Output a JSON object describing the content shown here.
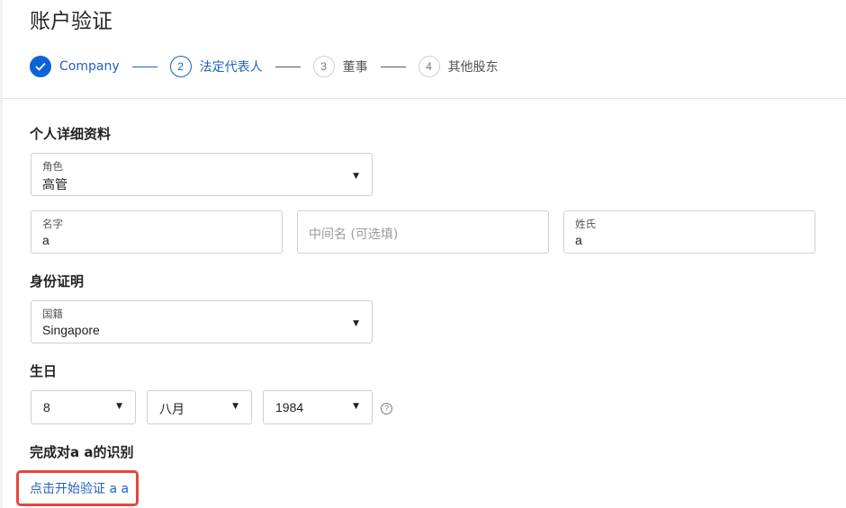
{
  "header": {
    "title": "账户验证"
  },
  "stepper": {
    "steps": [
      {
        "number": "",
        "label": "Company",
        "state": "done"
      },
      {
        "number": "2",
        "label": "法定代表人",
        "state": "active"
      },
      {
        "number": "3",
        "label": "董事",
        "state": "todo"
      },
      {
        "number": "4",
        "label": "其他股东",
        "state": "todo"
      }
    ]
  },
  "personal": {
    "title": "个人详细资料",
    "role": {
      "label": "角色",
      "value": "高管"
    },
    "first_name": {
      "label": "名字",
      "value": "a"
    },
    "middle_name": {
      "placeholder": "中间名 (可选填)"
    },
    "last_name": {
      "label": "姓氏",
      "value": "a"
    }
  },
  "identity": {
    "title": "身份证明",
    "nationality": {
      "label": "国籍",
      "value": "Singapore"
    }
  },
  "birthday": {
    "title": "生日",
    "day": "8",
    "month": "八月",
    "year": "1984",
    "help_glyph": "?"
  },
  "verification": {
    "title": "完成对a a的识别",
    "link_label": "点击开始验证 a a"
  },
  "colors": {
    "accent": "#0a63d8",
    "link": "#1f5fbf",
    "highlight": "#e8453c",
    "border": "#cfcfcf"
  }
}
